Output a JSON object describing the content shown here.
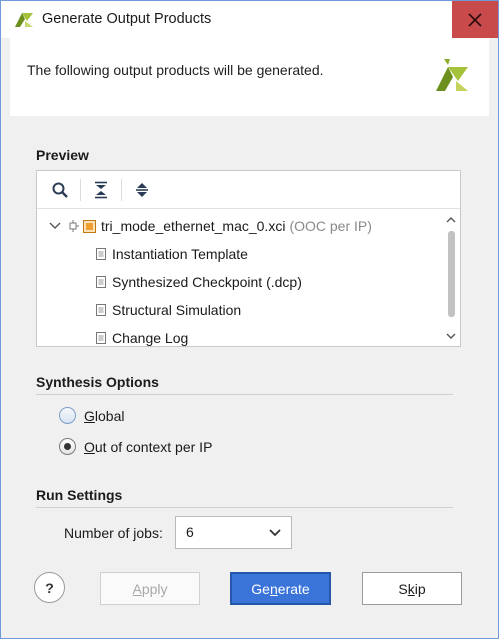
{
  "window": {
    "title": "Generate Output Products",
    "close_icon": "close-icon",
    "colors": {
      "title_close_bg": "#c84a4a",
      "primary": "#3a74d9",
      "accent_orange": "#f0a030"
    }
  },
  "header": {
    "message": "The following output products will be generated.",
    "logo_icon": "vivado-logo-icon"
  },
  "preview": {
    "title": "Preview",
    "toolbar": {
      "search_icon": "search-icon",
      "collapse_all_icon": "collapse-all-icon",
      "expand_all_icon": "expand-all-icon"
    },
    "tree": {
      "root": {
        "label": "tri_mode_ethernet_mac_0.xci",
        "hint": "(OOC per IP)",
        "expanded": true
      },
      "children": [
        {
          "label": "Instantiation Template"
        },
        {
          "label": "Synthesized Checkpoint (.dcp)"
        },
        {
          "label": "Structural Simulation"
        },
        {
          "label": "Change Log"
        }
      ]
    }
  },
  "synthesis_options": {
    "title": "Synthesis Options",
    "options": [
      {
        "label": "Global",
        "mnemonic": "G",
        "rest": "lobal",
        "selected": false
      },
      {
        "label": "Out of context per IP",
        "mnemonic": "O",
        "rest": "ut of context per IP",
        "selected": true
      }
    ]
  },
  "run_settings": {
    "title": "Run Settings",
    "jobs_label_pre": "Number of ",
    "jobs_label_mn": "j",
    "jobs_label_post": "obs:",
    "jobs_value": "6"
  },
  "buttons": {
    "help": "?",
    "apply_mn": "A",
    "apply_rest": "pply",
    "generate_pre": "Ge",
    "generate_mn": "n",
    "generate_post": "erate",
    "skip_pre": "S",
    "skip_mn": "k",
    "skip_post": "ip"
  }
}
